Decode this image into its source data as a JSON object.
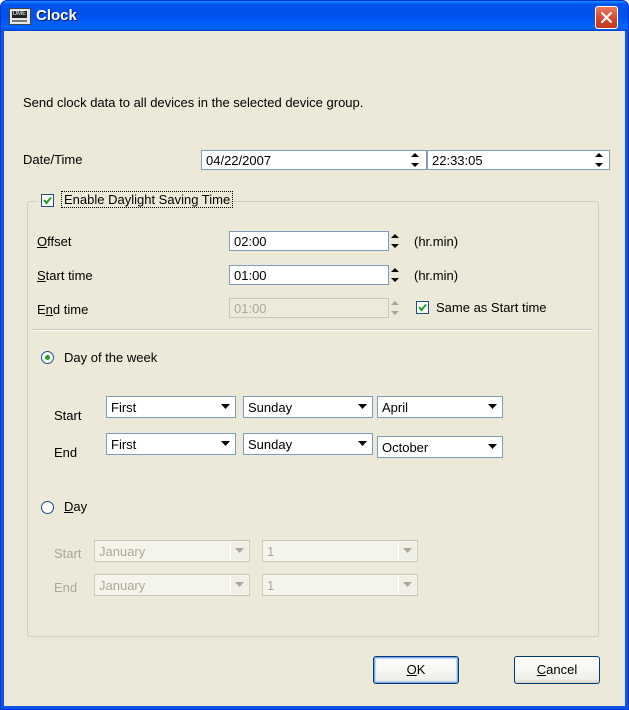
{
  "window": {
    "title": "Clock",
    "icon_text": "DME"
  },
  "description": "Send clock data to all devices in the selected device group.",
  "datetime": {
    "label": "Date/Time",
    "date": "04/22/2007",
    "time": "22:33:05"
  },
  "daylight": {
    "enable_label": "Enable Daylight Saving Time",
    "enabled": true,
    "offset_label": "Offset",
    "offset_value": "02:00",
    "start_label": "Start time",
    "start_value": "01:00",
    "end_label": "End time",
    "end_value": "01:00",
    "unit": "(hr.min)",
    "same_as_start_label": "Same as Start time",
    "same_as_start": true
  },
  "day_of_week": {
    "label": "Day of the week",
    "selected": true,
    "start_label": "Start",
    "end_label": "End",
    "start": {
      "ordinal": "First",
      "weekday": "Sunday",
      "month": "April"
    },
    "end": {
      "ordinal": "First",
      "weekday": "Sunday",
      "month": "October"
    }
  },
  "day": {
    "label": "Day",
    "selected": false,
    "start_label": "Start",
    "end_label": "End",
    "start": {
      "month": "January",
      "day": "1"
    },
    "end": {
      "month": "January",
      "day": "1"
    }
  },
  "buttons": {
    "ok": "OK",
    "cancel": "Cancel"
  }
}
